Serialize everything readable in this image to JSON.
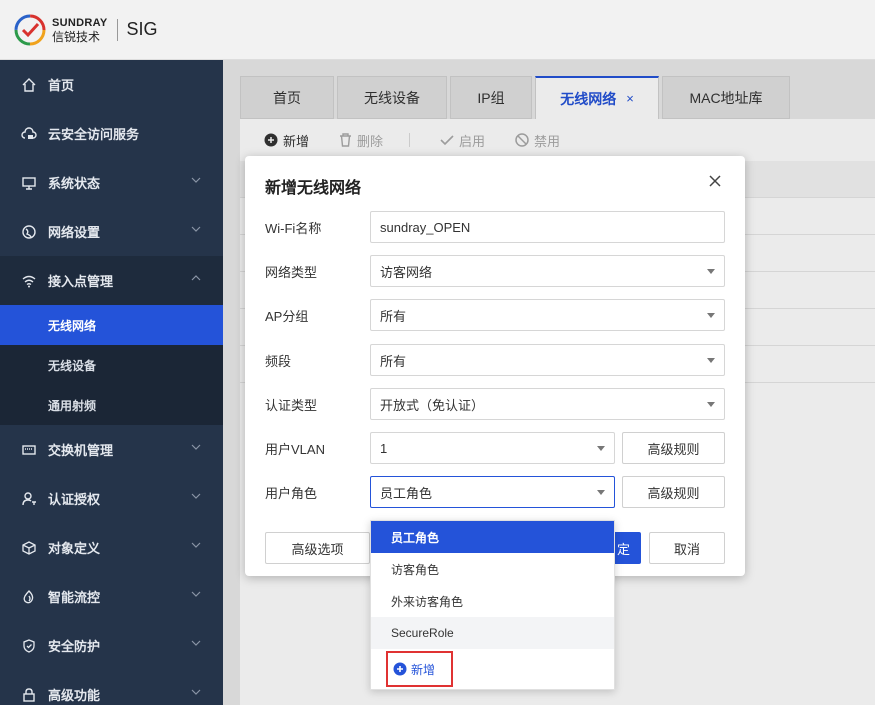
{
  "brand": {
    "name_en": "SUNDRAY",
    "name_cn": "信锐技术",
    "product": "SIG"
  },
  "sidebar": {
    "items": [
      {
        "label": "首页",
        "icon": "home-icon"
      },
      {
        "label": "云安全访问服务",
        "icon": "cloud-lock-icon"
      },
      {
        "label": "系统状态",
        "icon": "monitor-icon"
      },
      {
        "label": "网络设置",
        "icon": "globe-icon"
      },
      {
        "label": "接入点管理",
        "icon": "wifi-icon"
      },
      {
        "label": "交换机管理",
        "icon": "switch-icon"
      },
      {
        "label": "认证授权",
        "icon": "user-key-icon"
      },
      {
        "label": "对象定义",
        "icon": "cube-icon"
      },
      {
        "label": "智能流控",
        "icon": "flow-icon"
      },
      {
        "label": "安全防护",
        "icon": "shield-icon"
      },
      {
        "label": "高级功能",
        "icon": "lock-icon"
      }
    ],
    "subitems": [
      {
        "label": "无线网络"
      },
      {
        "label": "无线设备"
      },
      {
        "label": "通用射频"
      }
    ]
  },
  "tabs": [
    {
      "label": "首页"
    },
    {
      "label": "无线设备"
    },
    {
      "label": "IP组"
    },
    {
      "label": "无线网络",
      "close": "×"
    },
    {
      "label": "MAC地址库"
    }
  ],
  "toolbar": {
    "add": "新增",
    "delete": "删除",
    "enable": "启用",
    "disable": "禁用"
  },
  "dialog": {
    "title": "新增无线网络",
    "fields": {
      "ssid": {
        "label": "Wi-Fi名称",
        "value": "sundray_OPEN"
      },
      "net_type": {
        "label": "网络类型",
        "value": "访客网络"
      },
      "ap_group": {
        "label": "AP分组",
        "value": "所有"
      },
      "band": {
        "label": "频段",
        "value": "所有"
      },
      "auth_type": {
        "label": "认证类型",
        "value": "开放式（免认证）"
      },
      "vlan": {
        "label": "用户VLAN",
        "value": "1",
        "rule_btn": "高级规则"
      },
      "role": {
        "label": "用户角色",
        "value": "员工角色",
        "rule_btn": "高级规则"
      }
    },
    "advanced_btn": "高级选项",
    "ok_btn": "定",
    "cancel_btn": "取消"
  },
  "role_dropdown": {
    "options": [
      "员工角色",
      "访客角色",
      "外来访客角色",
      "SecureRole"
    ],
    "add_label": "新增"
  },
  "colors": {
    "accent": "#2453d9",
    "sidebar_bg": "#25344a",
    "highlight_border": "#e03232"
  }
}
